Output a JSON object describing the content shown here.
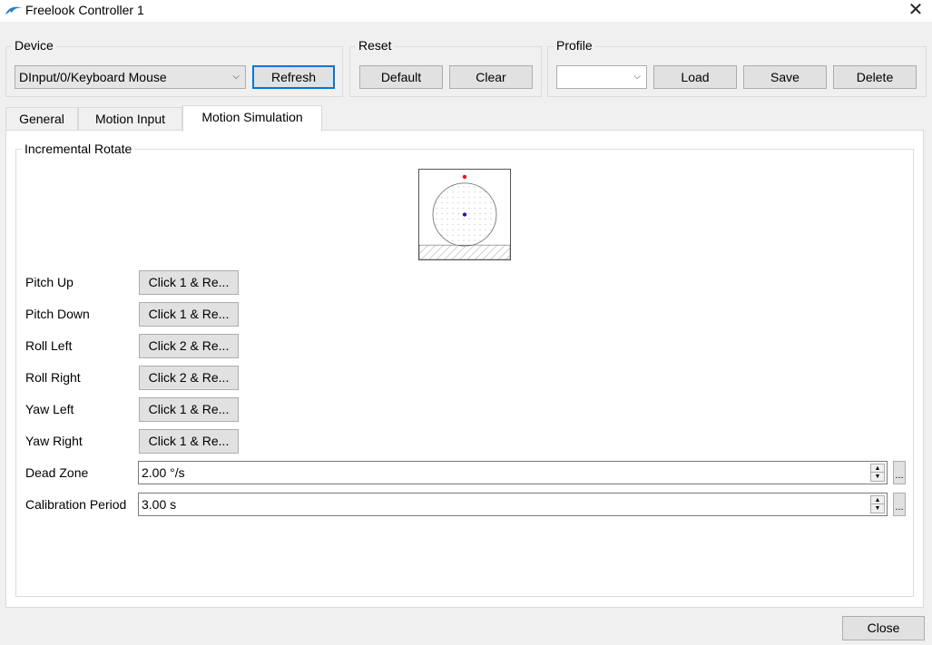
{
  "window": {
    "title": "Freelook Controller 1",
    "close_glyph": "✕"
  },
  "device": {
    "group_title": "Device",
    "selected": "DInput/0/Keyboard Mouse",
    "refresh_label": "Refresh"
  },
  "reset": {
    "group_title": "Reset",
    "default_label": "Default",
    "clear_label": "Clear"
  },
  "profile": {
    "group_title": "Profile",
    "selected": "",
    "load_label": "Load",
    "save_label": "Save",
    "delete_label": "Delete"
  },
  "tabs": [
    {
      "label": "General"
    },
    {
      "label": "Motion Input"
    },
    {
      "label": "Motion Simulation",
      "active": true
    }
  ],
  "panel": {
    "group_title": "Incremental Rotate",
    "mappings": [
      {
        "label": "Pitch Up",
        "value": "Click 1 & Re..."
      },
      {
        "label": "Pitch Down",
        "value": "Click 1 & Re..."
      },
      {
        "label": "Roll Left",
        "value": "Click 2 & Re..."
      },
      {
        "label": "Roll Right",
        "value": "Click 2 & Re..."
      },
      {
        "label": "Yaw Left",
        "value": "Click 1 & Re..."
      },
      {
        "label": "Yaw Right",
        "value": "Click 1 & Re..."
      }
    ],
    "dead_zone": {
      "label": "Dead Zone",
      "value": "2.00 °/s"
    },
    "calibration": {
      "label": "Calibration Period",
      "value": "3.00 s"
    },
    "more_label": "..."
  },
  "footer": {
    "close_label": "Close"
  },
  "colors": {
    "accent": "#0078d7",
    "indicator_red": "#e8151e",
    "indicator_blue": "#1a1ab8"
  }
}
